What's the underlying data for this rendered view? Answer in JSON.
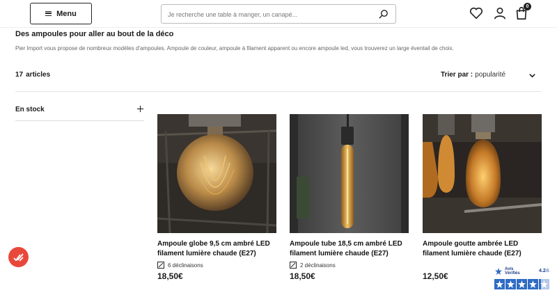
{
  "header": {
    "menu_label": "Menu",
    "search_placeholder": "Je recherche une table à manger, un canapé...",
    "cart_count": "0"
  },
  "intro": {
    "title": "Des ampoules pour aller au bout de la déco",
    "text": "Pier Import vous propose de nombreux modèles d'ampoules. Ampoule de couleur, ampoule à filament apparent ou encore ampoule led, vous trouverez un large éventail de choix."
  },
  "toolbar": {
    "count": "17",
    "count_label": "articles",
    "sort_label": "Trier par :",
    "sort_value": "popularité"
  },
  "filters": [
    {
      "label": "En stock"
    }
  ],
  "products": [
    {
      "title": "Ampoule globe 9,5 cm ambré LED filament lumière chaude (E27)",
      "variants": "6 déclinaisons",
      "price": "18,50€",
      "image": "globe-bulb"
    },
    {
      "title": "Ampoule tube 18,5 cm ambré LED filament lumière chaude (E27)",
      "variants": "2 déclinaisons",
      "price": "18,50€",
      "image": "tube-bulb"
    },
    {
      "title": "Ampoule goutte ambrée LED filament lumière chaude (E27)",
      "variants": "",
      "price": "12,50€",
      "image": "drop-bulb"
    }
  ],
  "reviews_widget": {
    "brand_line1": "Avis",
    "brand_line2": "Vérifiés",
    "rating": "4.2",
    "rating_out_of": "/5",
    "stars_value": 4.2
  },
  "colors": {
    "accent_red": "#e8483a",
    "avis_blue": "#2f6cc4"
  }
}
